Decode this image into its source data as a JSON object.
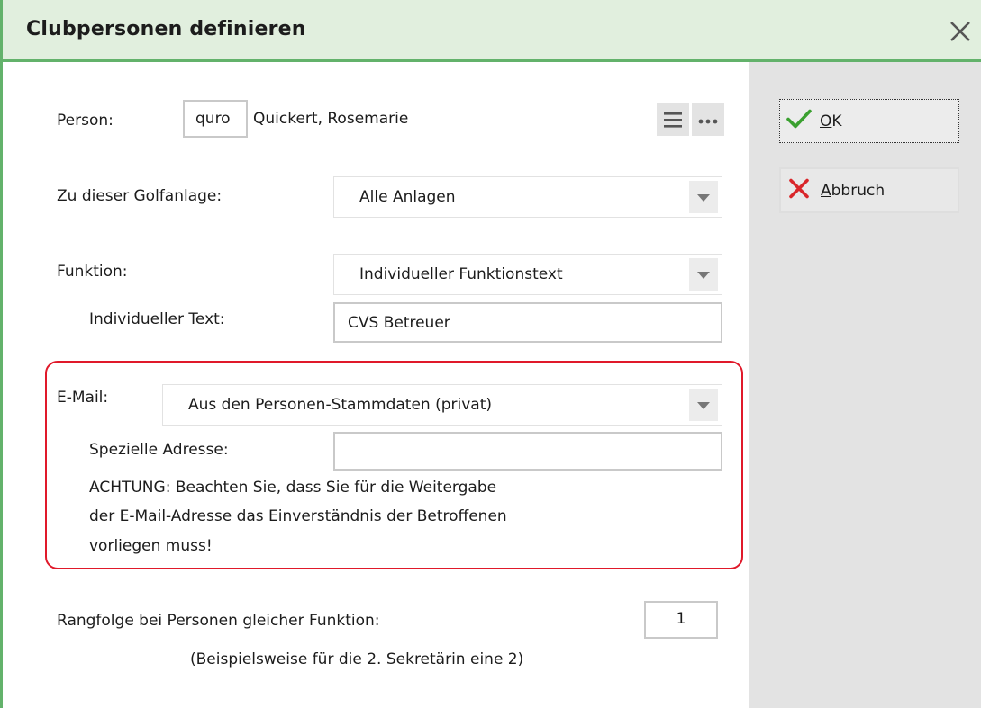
{
  "window": {
    "title": "Clubpersonen definieren"
  },
  "person": {
    "label": "Person:",
    "code": "quro",
    "name": "Quickert, Rosemarie"
  },
  "golfanlage": {
    "label": "Zu dieser Golfanlage:",
    "selected": "Alle Anlagen"
  },
  "funktion": {
    "label": "Funktion:",
    "selected": "Individueller Funktionstext",
    "individual_label": "Individueller Text:",
    "individual_value": "CVS Betreuer"
  },
  "email": {
    "label": "E-Mail:",
    "selected": "Aus den Personen-Stammdaten (privat)",
    "special_label": "Spezielle Adresse:",
    "special_value": "",
    "warning_line1": "ACHTUNG: Beachten Sie, dass Sie für die Weitergabe",
    "warning_line2": "der E-Mail-Adresse das Einverständnis der Betroffenen",
    "warning_line3": "vorliegen muss!",
    "highlight_color": "#e0192a"
  },
  "rang": {
    "label": "Rangfolge bei Personen gleicher Funktion:",
    "value": "1",
    "hint": "(Beispielsweise für die 2. Sekretärin eine 2)"
  },
  "buttons": {
    "ok_mnemonic": "O",
    "ok_rest": "K",
    "cancel_mnemonic": "A",
    "cancel_rest": "bbruch"
  },
  "icons": [
    "close-icon",
    "list-icon",
    "more-icon",
    "checkmark-icon",
    "cross-icon",
    "dropdown-arrow-icon"
  ],
  "colors": {
    "accent_green": "#63b26b",
    "title_bg": "#e1efde",
    "ok_green": "#3aa02f",
    "cancel_red": "#d9262a"
  }
}
